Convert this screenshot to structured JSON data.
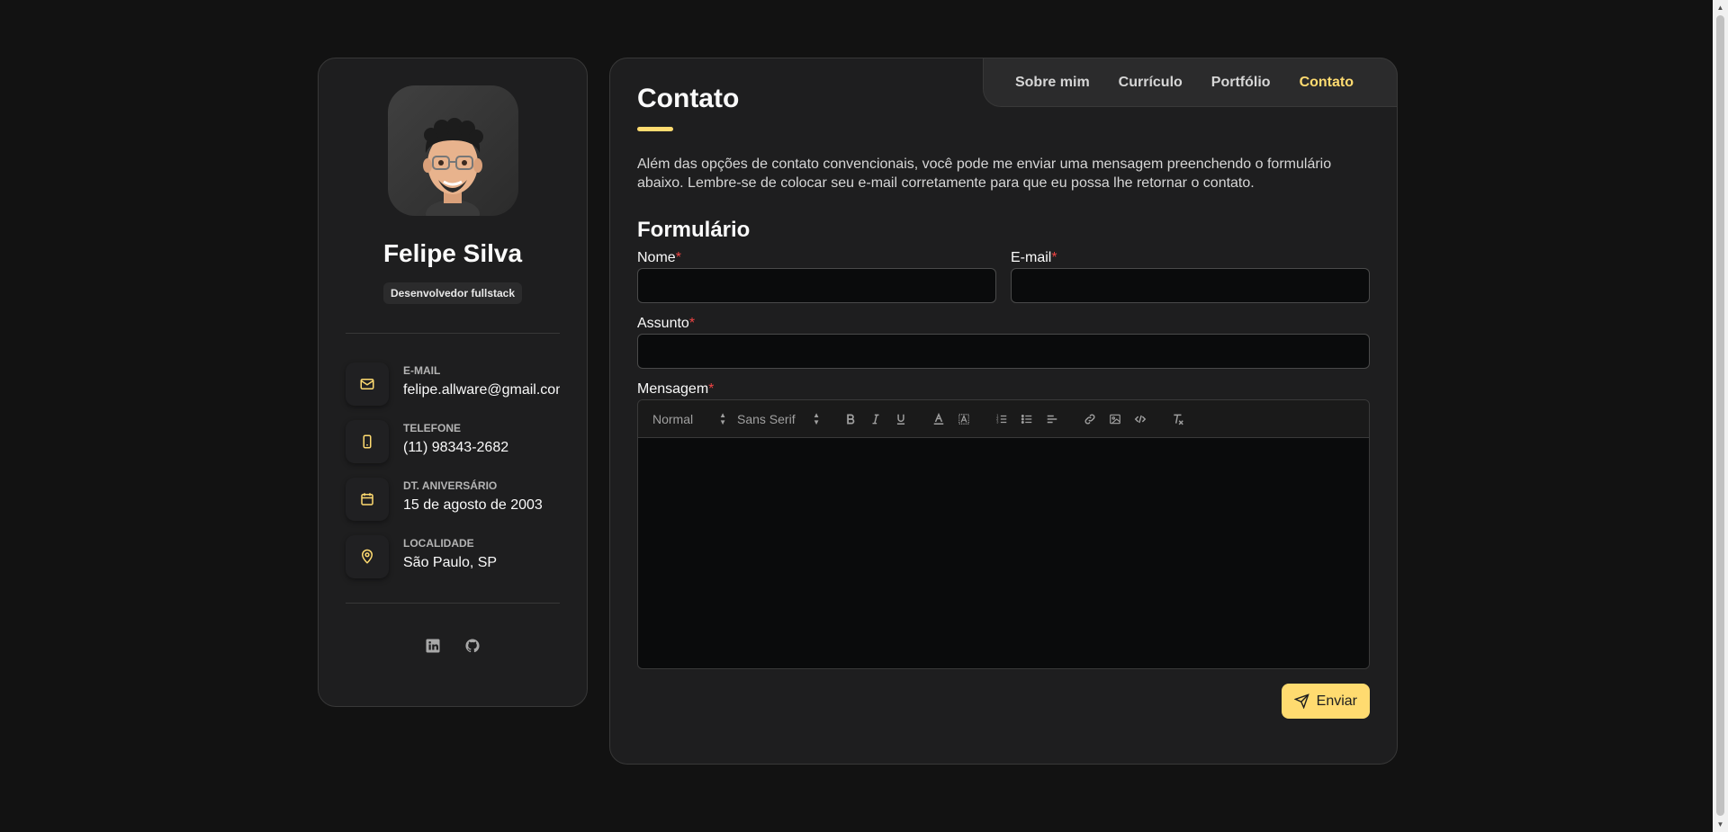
{
  "profile": {
    "name": "Felipe Silva",
    "title": "Desenvolvedor fullstack"
  },
  "contacts": [
    {
      "label": "E-MAIL",
      "value": "felipe.allware@gmail.com",
      "icon": "mail-icon"
    },
    {
      "label": "TELEFONE",
      "value": "(11) 98343-2682",
      "icon": "phone-icon"
    },
    {
      "label": "DT. ANIVERSÁRIO",
      "value": "15 de agosto de 2003",
      "icon": "calendar-icon"
    },
    {
      "label": "LOCALIDADE",
      "value": "São Paulo, SP",
      "icon": "map-pin-icon"
    }
  ],
  "social": [
    "linkedin-icon",
    "github-icon"
  ],
  "nav": {
    "items": [
      "Sobre mim",
      "Currículo",
      "Portfólio",
      "Contato"
    ],
    "active": "Contato"
  },
  "main": {
    "title": "Contato",
    "intro": "Além das opções de contato convencionais, você pode me enviar uma mensagem preenchendo o formulário abaixo. Lembre-se de colocar seu e-mail corretamente para que eu possa lhe retornar o contato.",
    "form_title": "Formulário",
    "fields": {
      "name_label": "Nome",
      "email_label": "E-mail",
      "subject_label": "Assunto",
      "message_label": "Mensagem",
      "required_mark": "*"
    },
    "toolbar": {
      "header_select": "Normal",
      "font_select": "Sans Serif"
    },
    "submit_label": "Enviar"
  },
  "colors": {
    "accent": "#ffdb70",
    "background": "#121212",
    "panel": "#1e1e1f",
    "required": "#ef4444"
  }
}
